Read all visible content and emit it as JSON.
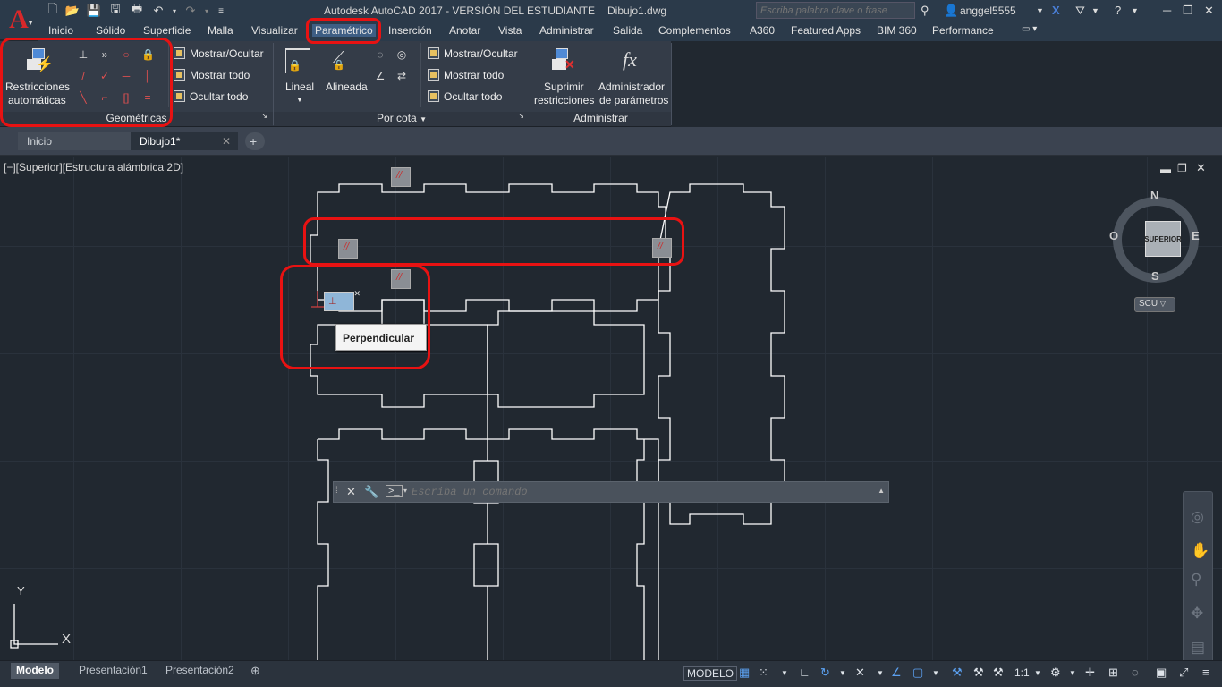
{
  "app": {
    "title": "Autodesk AutoCAD 2017 - VERSIÓN DEL ESTUDIANTE",
    "file": "Dibujo1.dwg",
    "logo": "A"
  },
  "search": {
    "placeholder": "Escriba palabra clave o frase"
  },
  "user": {
    "name": "anggel5555"
  },
  "menus": [
    "Inicio",
    "Sólido",
    "Superficie",
    "Malla",
    "Visualizar",
    "Paramétrico",
    "Inserción",
    "Anotar",
    "Vista",
    "Administrar",
    "Salida",
    "Complementos",
    "A360",
    "Featured Apps",
    "BIM 360",
    "Performance"
  ],
  "active_menu": "Paramétrico",
  "ribbon": {
    "geometricas": {
      "title": "Geométricas",
      "auto_label1": "Restricciones",
      "auto_label2": "automáticas",
      "show_hide": "Mostrar/Ocultar",
      "show_all": "Mostrar todo",
      "hide_all": "Ocultar todo"
    },
    "por_cota": {
      "title": "Por cota",
      "lineal": "Lineal",
      "alineada": "Alineada",
      "show_hide": "Mostrar/Ocultar",
      "show_all": "Mostrar todo",
      "hide_all": "Ocultar todo"
    },
    "administrar": {
      "title": "Administrar",
      "suprimir1": "Suprimir",
      "suprimir2": "restricciones",
      "admin1": "Administrador",
      "admin2": "de parámetros"
    }
  },
  "doc_tabs": [
    "Inicio",
    "Dibujo1*"
  ],
  "viewport": {
    "label": "[−][Superior][Estructura alámbrica 2D]"
  },
  "tooltip": {
    "text": "Perpendicular"
  },
  "viewcube": {
    "face": "SUPERIOR",
    "north": "N",
    "south": "S",
    "east": "E",
    "west": "O",
    "ucs": "SCU"
  },
  "ucs_icon": {
    "x": "X",
    "y": "Y"
  },
  "command": {
    "placeholder": "Escriba un comando"
  },
  "layout_tabs": [
    "Modelo",
    "Presentación1",
    "Presentación2"
  ],
  "status": {
    "space": "MODELO",
    "scale": "1:1"
  },
  "colors": {
    "accent_red": "#e81212",
    "drawing_line": "#ffffff",
    "canvas": "#212830"
  }
}
